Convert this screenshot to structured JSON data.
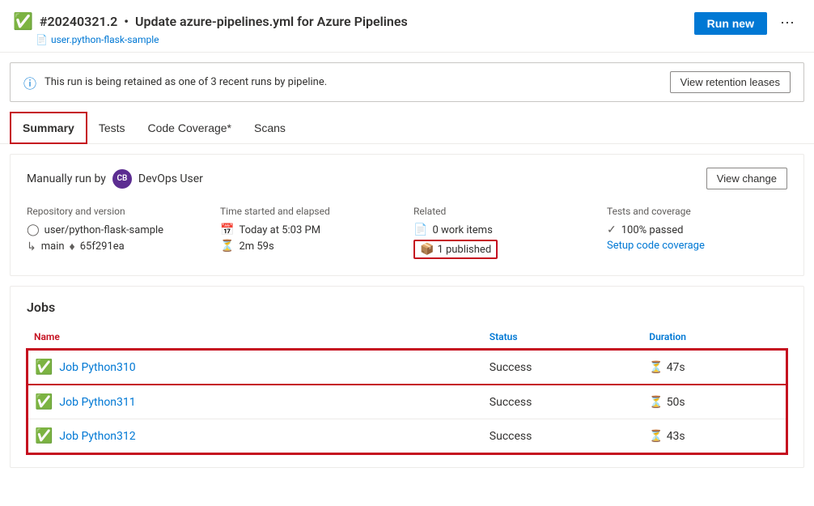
{
  "header": {
    "run_id": "#20240321.2",
    "separator": "•",
    "title": "Update azure-pipelines.yml for Azure Pipelines",
    "repo_link": "user.python-flask-sample",
    "run_new_label": "Run new",
    "more_icon": "⋯"
  },
  "banner": {
    "message": "This run is being retained as one of 3 recent runs by pipeline.",
    "cta_label": "View retention leases"
  },
  "tabs": [
    {
      "label": "Summary",
      "active": true
    },
    {
      "label": "Tests",
      "active": false
    },
    {
      "label": "Code Coverage*",
      "active": false
    },
    {
      "label": "Scans",
      "active": false
    }
  ],
  "summary": {
    "manually_run_label": "Manually run by",
    "user_initials": "CB",
    "user_name": "DevOps User",
    "view_change_label": "View change",
    "repo_section": {
      "label": "Repository and version",
      "repo": "user/python-flask-sample",
      "branch": "main",
      "commit": "65f291ea"
    },
    "time_section": {
      "label": "Time started and elapsed",
      "started": "Today at 5:03 PM",
      "elapsed": "2m 59s"
    },
    "related_section": {
      "label": "Related",
      "work_items": "0 work items",
      "published": "1 published"
    },
    "tests_section": {
      "label": "Tests and coverage",
      "passed": "100% passed",
      "setup_link": "Setup code coverage"
    }
  },
  "jobs": {
    "title": "Jobs",
    "col_name": "Name",
    "col_status": "Status",
    "col_duration": "Duration",
    "rows": [
      {
        "name": "Job Python310",
        "status": "Success",
        "duration": "47s"
      },
      {
        "name": "Job Python311",
        "status": "Success",
        "duration": "50s"
      },
      {
        "name": "Job Python312",
        "status": "Success",
        "duration": "43s"
      }
    ]
  }
}
